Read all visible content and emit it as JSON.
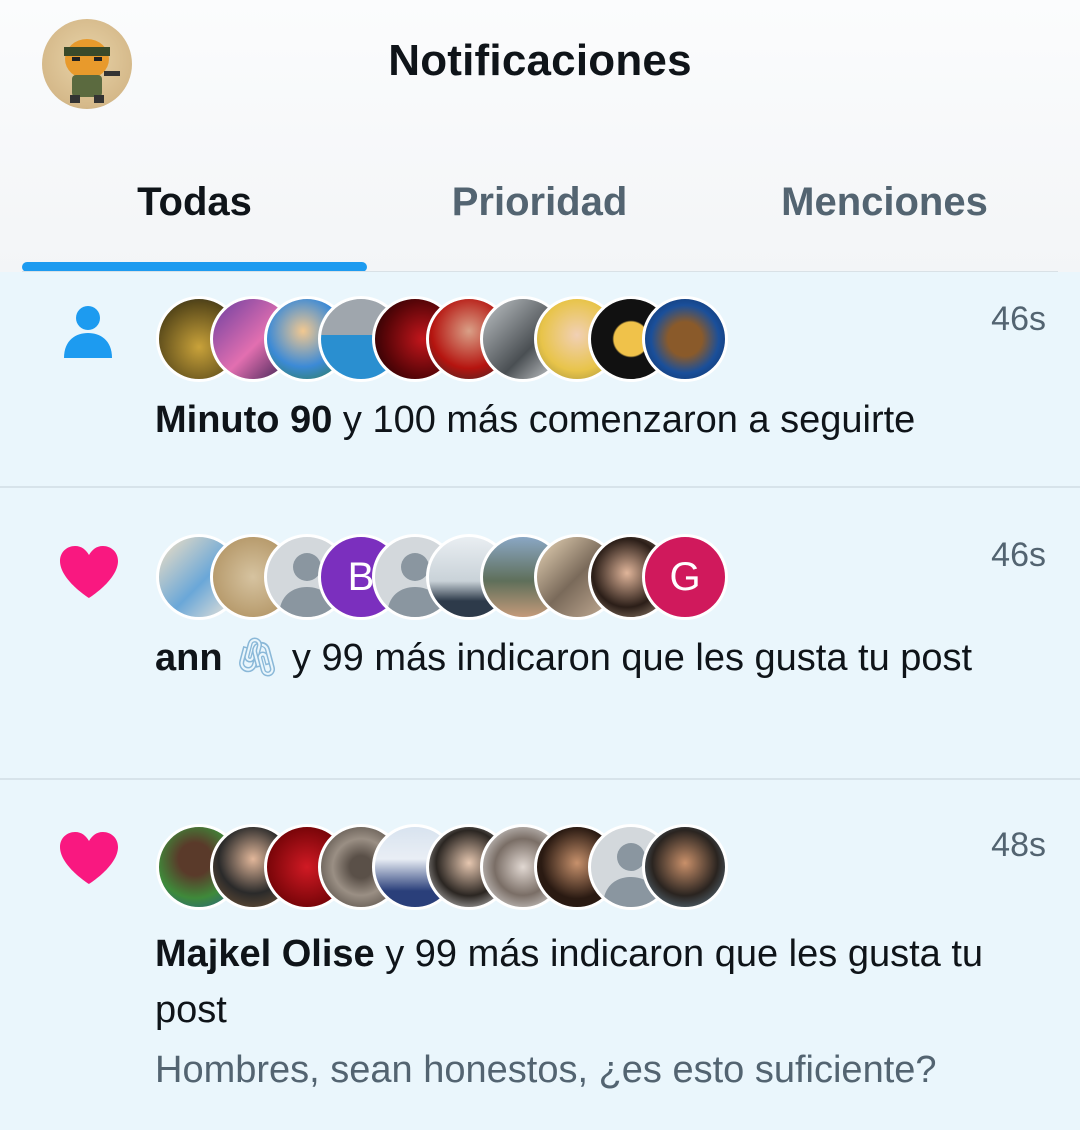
{
  "header": {
    "title": "Notificaciones"
  },
  "tabs": [
    {
      "label": "Todas",
      "active": true
    },
    {
      "label": "Prioridad",
      "active": false
    },
    {
      "label": "Menciones",
      "active": false
    }
  ],
  "colors": {
    "accent": "#1d9bf0",
    "like": "#f91880",
    "follow": "#1d9bf0"
  },
  "notifications": [
    {
      "type_icon": "person-icon",
      "time": "46s",
      "actor": "Minuto 90",
      "text": " y 100 más comenzaron a seguirte",
      "avatar_count": 10
    },
    {
      "type_icon": "heart-icon",
      "time": "46s",
      "actor": "ann",
      "actor_emoji": "🖇",
      "text": " y 99 más indicaron que les gusta tu post",
      "avatar_letters": [
        "B",
        "G"
      ],
      "avatar_count": 10
    },
    {
      "type_icon": "heart-icon",
      "time": "48s",
      "actor": "Majkel Olise",
      "text": " y 99 más indicaron que les gusta tu post",
      "snippet": "Hombres, sean honestos, ¿es esto suficiente?",
      "avatar_count": 10
    }
  ]
}
